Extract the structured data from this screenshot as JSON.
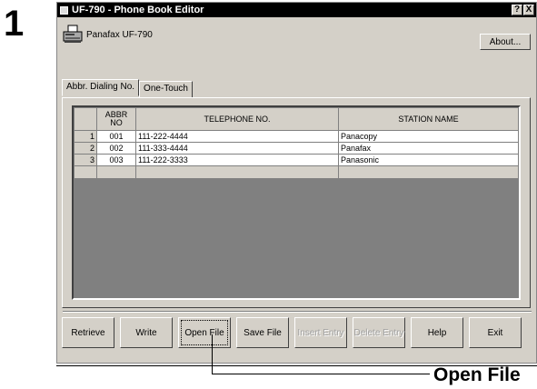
{
  "step_number": "1",
  "window": {
    "title": "UF-790 - Phone Book Editor",
    "help_button": "?",
    "close_button": "X"
  },
  "device": {
    "name": "Panafax UF-790",
    "icon": "fax-machine-icon"
  },
  "about_button": "About...",
  "tabs": [
    {
      "label": "Abbr. Dialing No.",
      "active": true
    },
    {
      "label": "One-Touch",
      "active": false
    }
  ],
  "table": {
    "headers": {
      "abbr_no": "ABBR NO",
      "telephone": "TELEPHONE NO.",
      "station": "STATION NAME"
    },
    "rows": [
      {
        "num": "1",
        "abbr": "001",
        "tel": "111-222-4444",
        "station": "Panacopy"
      },
      {
        "num": "2",
        "abbr": "002",
        "tel": "111-333-4444",
        "station": "Panafax"
      },
      {
        "num": "3",
        "abbr": "003",
        "tel": "111-222-3333",
        "station": "Panasonic"
      }
    ]
  },
  "buttons": {
    "retrieve": "Retrieve",
    "write": "Write",
    "open_file": "Open File",
    "save_file": "Save File",
    "insert_entry": "Insert Entry",
    "delete_entry": "Delete Entry",
    "help": "Help",
    "exit": "Exit"
  },
  "callout": {
    "label": "Open File"
  }
}
